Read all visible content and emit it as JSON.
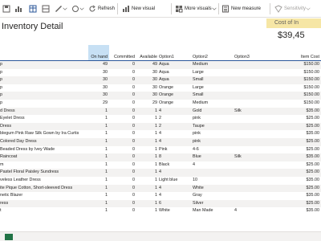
{
  "toolbar": {
    "refresh_label": "Refresh",
    "new_visual_label": "New visual",
    "more_visuals_label": "More visuals",
    "new_measure_label": "New measure",
    "sensitivity_label": "Sensitivity",
    "colors": {
      "accent": "#217346",
      "table_icon": "#2b579a"
    }
  },
  "report": {
    "title": "Inventory Detail",
    "card_label": "Cost of In",
    "card_value": "$39,45"
  },
  "table": {
    "headers": [
      "",
      "On hand",
      "Committed",
      "Available",
      "Option1",
      "Option2",
      "Option3",
      "Item Cost"
    ],
    "sorted_column": "On hand",
    "rows": [
      [
        "p",
        "49",
        "0",
        "49",
        "Aqua",
        "Medium",
        "",
        "$150.00"
      ],
      [
        "p",
        "30",
        "0",
        "30",
        "Aqua",
        "Large",
        "",
        "$150.00"
      ],
      [
        "p",
        "30",
        "0",
        "30",
        "Aqua",
        "Small",
        "",
        "$150.00"
      ],
      [
        "p",
        "30",
        "0",
        "30",
        "Orange",
        "Large",
        "",
        "$150.00"
      ],
      [
        "p",
        "30",
        "0",
        "30",
        "Orange",
        "Small",
        "",
        "$150.00"
      ],
      [
        "p",
        "29",
        "0",
        "29",
        "Orange",
        "Medium",
        "",
        "$150.00"
      ],
      [
        "d Dress",
        "1",
        "0",
        "1",
        "4",
        "Gold",
        "Silk",
        "$35.00"
      ],
      [
        "Eyelet Dress",
        "1",
        "0",
        "1",
        "2",
        "pink",
        "",
        "$25.00"
      ],
      [
        "Dress",
        "1",
        "0",
        "1",
        "2",
        "Taupe",
        "",
        "$25.00"
      ],
      [
        "blegum Pink Raw Silk Gown by Ira Curtis",
        "1",
        "0",
        "1",
        "4",
        "pink",
        "",
        "$35.00"
      ],
      [
        "Colored Day Dress",
        "1",
        "0",
        "1",
        "4",
        "pink",
        "",
        "$25.00"
      ],
      [
        "Beaded Dress by Ivey Wade",
        "1",
        "0",
        "1",
        "Pink",
        "4-6",
        "",
        "$25.00"
      ],
      [
        "Raincoat",
        "1",
        "0",
        "1",
        "8",
        "Blue",
        "Silk",
        "$35.00"
      ],
      [
        "m",
        "1",
        "0",
        "1",
        "Black",
        "4",
        "",
        "$25.00"
      ],
      [
        "Pastel Floral Paisley Sundress",
        "1",
        "0",
        "1",
        "4",
        "",
        "",
        "$25.00"
      ],
      [
        "veless Leather Dress",
        "1",
        "0",
        "1",
        "Light blue",
        "10",
        "",
        "$35.00"
      ],
      [
        "ite Pique Cotton, Short-sleeved Dress",
        "1",
        "0",
        "1",
        "4",
        "White",
        "",
        "$25.00"
      ],
      [
        "netic Blazer",
        "1",
        "0",
        "1",
        "4",
        "Gray",
        "",
        "$35.00"
      ],
      [
        "ress",
        "1",
        "0",
        "1",
        "6",
        "Silver",
        "",
        "$25.00"
      ],
      [
        "t",
        "1",
        "0",
        "1",
        "White",
        "Man Made",
        "4",
        "$35.00"
      ]
    ]
  }
}
